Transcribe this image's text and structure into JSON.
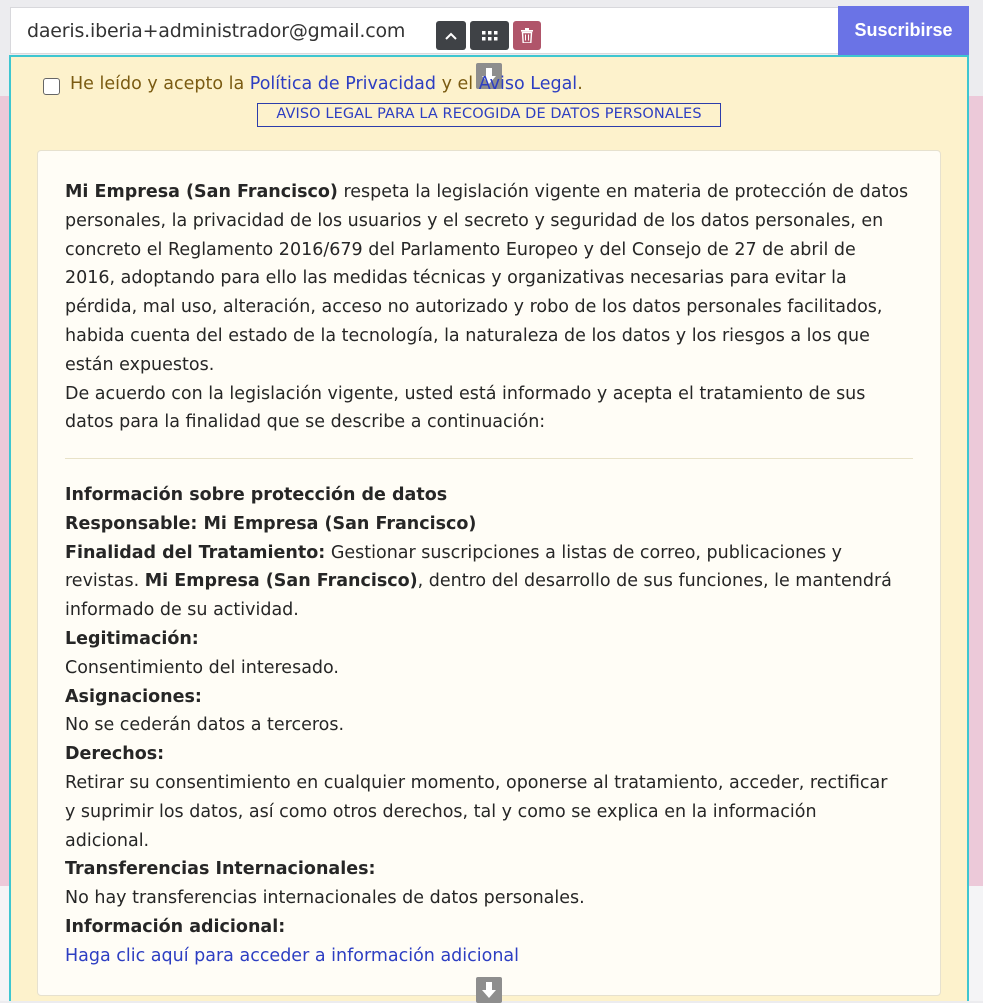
{
  "subscribe": {
    "email_value": "daeris.iberia+administrador@gmail.com",
    "button_label": "Suscribirse"
  },
  "consent": {
    "prefix": "He leído y acepto la ",
    "privacy_link": "Política de Privacidad",
    "connector": " y el ",
    "legal_link": "Aviso Legal",
    "suffix": "."
  },
  "legal_notice_link": "AVISO LEGAL PARA LA RECOGIDA DE DATOS PERSONALES",
  "intro": {
    "company": "Mi Empresa (San Francisco)",
    "line1_rest": " respeta la legislación vigente en materia de protección de datos",
    "line2": "personales, la privacidad de los usuarios y el secreto y seguridad de los datos personales, en",
    "line3": "concreto el Reglamento 2016/679 del Parlamento Europeo y del Consejo de 27 de abril de",
    "line4": "2016, adoptando para ello las medidas técnicas y organizativas necesarias para evitar la",
    "line5": "pérdida, mal uso, alteración, acceso no autorizado y robo de los datos personales facilitados,",
    "line6": "habida cuenta del estado de la tecnología, la naturaleza de los datos y los riesgos a los que",
    "line7": "están expuestos.",
    "line8": "De acuerdo con la legislación vigente, usted está informado y acepta el tratamiento de sus",
    "line9": "datos para la finalidad que se describe a continuación:"
  },
  "info": {
    "heading": "Información sobre protección de datos",
    "responsible": "Responsable: Mi Empresa (San Francisco)",
    "purpose_label": "Finalidad del Tratamiento:",
    "purpose_text1": " Gestionar suscripciones a listas de correo, publicaciones y",
    "purpose_text2": "revistas. ",
    "purpose_company": "Mi Empresa (San Francisco)",
    "purpose_text3": ", dentro del desarrollo de sus funciones, le mantendrá",
    "purpose_text4": "informado de su actividad.",
    "legitimation_label": "Legitimación:",
    "legitimation_text": "Consentimiento del interesado.",
    "assignments_label": "Asignaciones:",
    "assignments_text": "No se cederán datos a terceros.",
    "rights_label": "Derechos:",
    "rights_text1": "Retirar su consentimiento en cualquier momento, oponerse al tratamiento, acceder, rectificar",
    "rights_text2": "y suprimir los datos, así como otros derechos, tal y como se explica en la información",
    "rights_text3": "adicional.",
    "transfers_label": "Transferencias Internacionales:",
    "transfers_text": "No hay transferencias internacionales de datos personales.",
    "additional_label": "Información adicional:",
    "additional_link": "Haga clic aquí para acceder a información adicional"
  },
  "colors": {
    "subscribe_button": "#6a73e6",
    "panel_background": "#fdf2cc",
    "panel_border": "#3ec6d0",
    "link": "#2d3ec2",
    "delete_button": "#b0556a"
  }
}
